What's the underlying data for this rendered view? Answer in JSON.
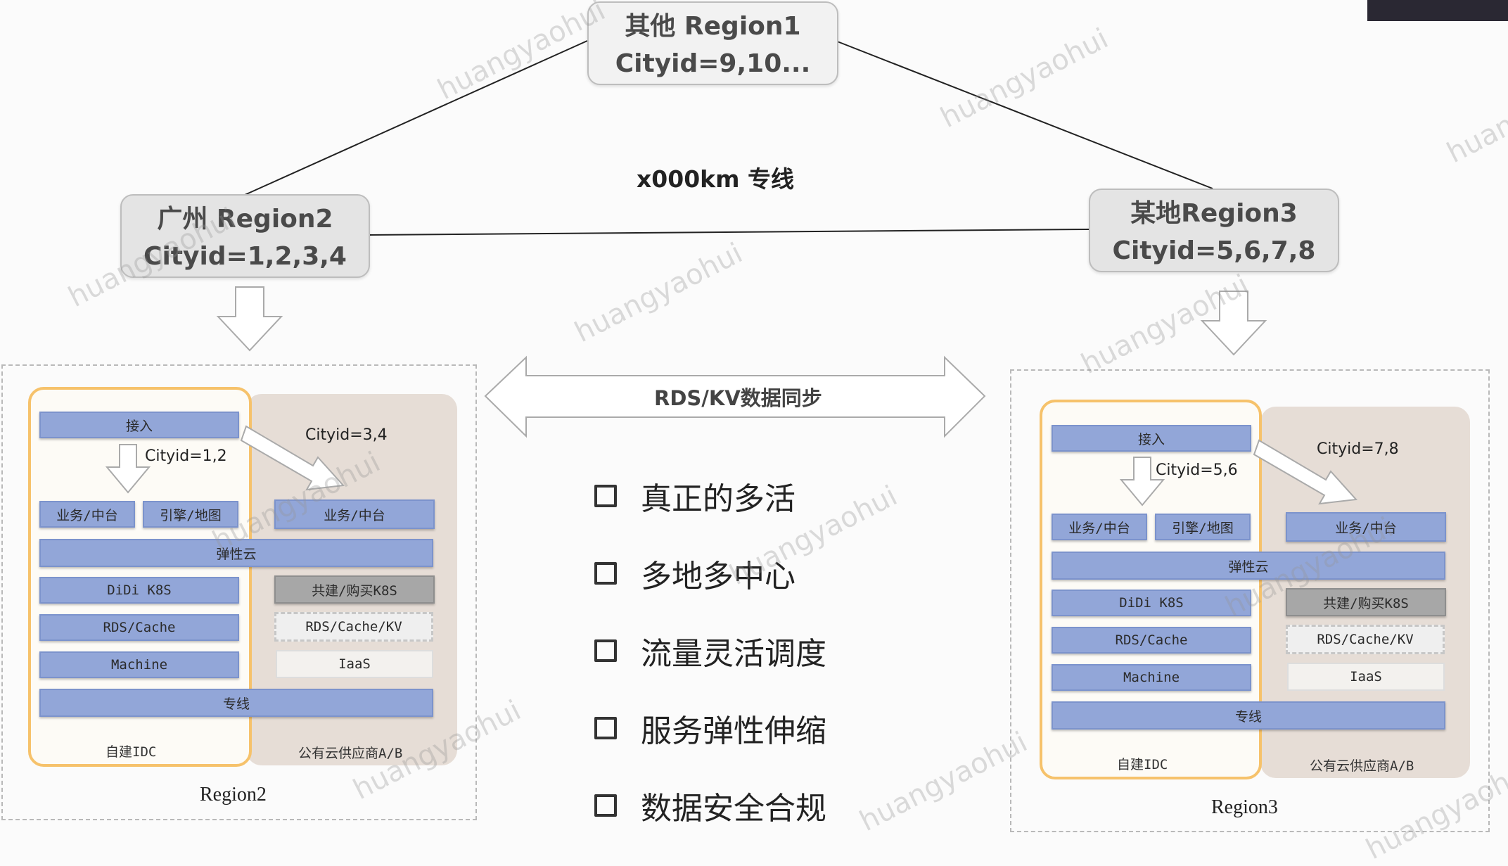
{
  "regions": {
    "region1": {
      "name": "其他 Region1",
      "cityid": "Cityid=9,10..."
    },
    "region2": {
      "name": "广州 Region2",
      "cityid": "Cityid=1,2,3,4"
    },
    "region3": {
      "name": "某地Region3",
      "cityid": "Cityid=5,6,7,8"
    }
  },
  "line_label": "x000km 专线",
  "sync_label": "RDS/KV数据同步",
  "bullets": [
    "真正的多活",
    "多地多中心",
    "流量灵活调度",
    "服务弹性伸缩",
    "数据安全合规"
  ],
  "left_dc": {
    "caption": "Region2",
    "idc_caption": "自建IDC",
    "cloud_caption": "公有云供应商A/B",
    "idc_cityid": "Cityid=1,2",
    "cloud_cityid": "Cityid=3,4"
  },
  "right_dc": {
    "caption": "Region3",
    "idc_caption": "自建IDC",
    "cloud_caption": "公有云供应商A/B",
    "idc_cityid": "Cityid=5,6",
    "cloud_cityid": "Cityid=7,8"
  },
  "layers": {
    "access": "接入",
    "business": "业务/中台",
    "engine": "引擎/地图",
    "elastic_cloud": "弹性云",
    "k8s": "DiDi K8S",
    "shared_k8s": "共建/购买K8S",
    "rds_cache": "RDS/Cache",
    "rds_cache_kv": "RDS/Cache/KV",
    "machine": "Machine",
    "iaas": "IaaS",
    "dedicated_line": "专线"
  },
  "watermark": "huangyaohui",
  "colors": {
    "layer_blue": "#92a6d8",
    "idc_border": "#f6c26b",
    "cloud_bg": "#e6ddd6",
    "region_box": "#e4e4e4"
  }
}
